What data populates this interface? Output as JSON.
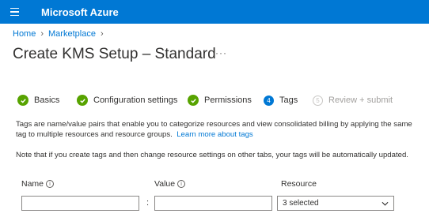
{
  "header": {
    "brand": "Microsoft Azure"
  },
  "breadcrumb": [
    {
      "label": "Home"
    },
    {
      "label": "Marketplace"
    }
  ],
  "page": {
    "title": "Create KMS Setup – Standard",
    "more": "···"
  },
  "tabs": [
    {
      "label": "Basics",
      "state": "done"
    },
    {
      "label": "Configuration settings",
      "state": "done"
    },
    {
      "label": "Permissions",
      "state": "done"
    },
    {
      "label": "Tags",
      "number": "4",
      "state": "active"
    },
    {
      "label": "Review + submit",
      "number": "5",
      "state": "disabled"
    }
  ],
  "description": {
    "text": "Tags are name/value pairs that enable you to categorize resources and view consolidated billing by applying the same tag to multiple resources and resource groups.",
    "link": "Learn more about tags"
  },
  "note": "Note that if you create tags and then change resource settings on other tabs, your tags will be automatically updated.",
  "table": {
    "columns": {
      "name": "Name",
      "value": "Value",
      "resource": "Resource"
    },
    "row": {
      "name": "",
      "separator": ":",
      "value": "",
      "resource": "3 selected"
    }
  },
  "colors": {
    "brand": "#0078d4",
    "success": "#57a300",
    "link": "#0078d4"
  }
}
